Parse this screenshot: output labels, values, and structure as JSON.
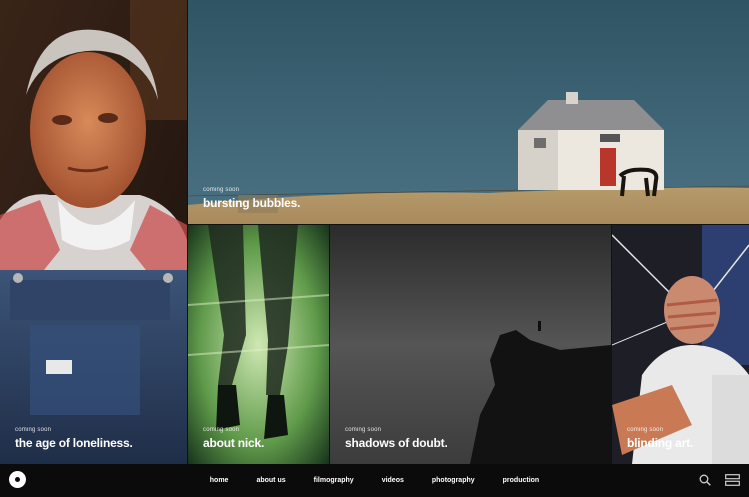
{
  "tiles": [
    {
      "id": "t-age",
      "status": "coming soon",
      "title": "the age of loneliness."
    },
    {
      "id": "t-bubbles",
      "status": "coming soon",
      "title": "bursting bubbles."
    },
    {
      "id": "t-nick",
      "status": "coming soon",
      "title": "about nick."
    },
    {
      "id": "t-shadows",
      "status": "coming soon",
      "title": "shadows of doubt."
    },
    {
      "id": "t-blind",
      "status": "coming soon",
      "title": "blinding art."
    }
  ],
  "nav": {
    "items": [
      "home",
      "about us",
      "filmography",
      "videos",
      "photography",
      "production"
    ]
  },
  "icons": {
    "logo": "disc-logo-icon",
    "search": "search-icon",
    "menu": "hamburger-menu-icon"
  },
  "colors": {
    "navbar": "#0b0b0b",
    "text": "#ffffff"
  }
}
